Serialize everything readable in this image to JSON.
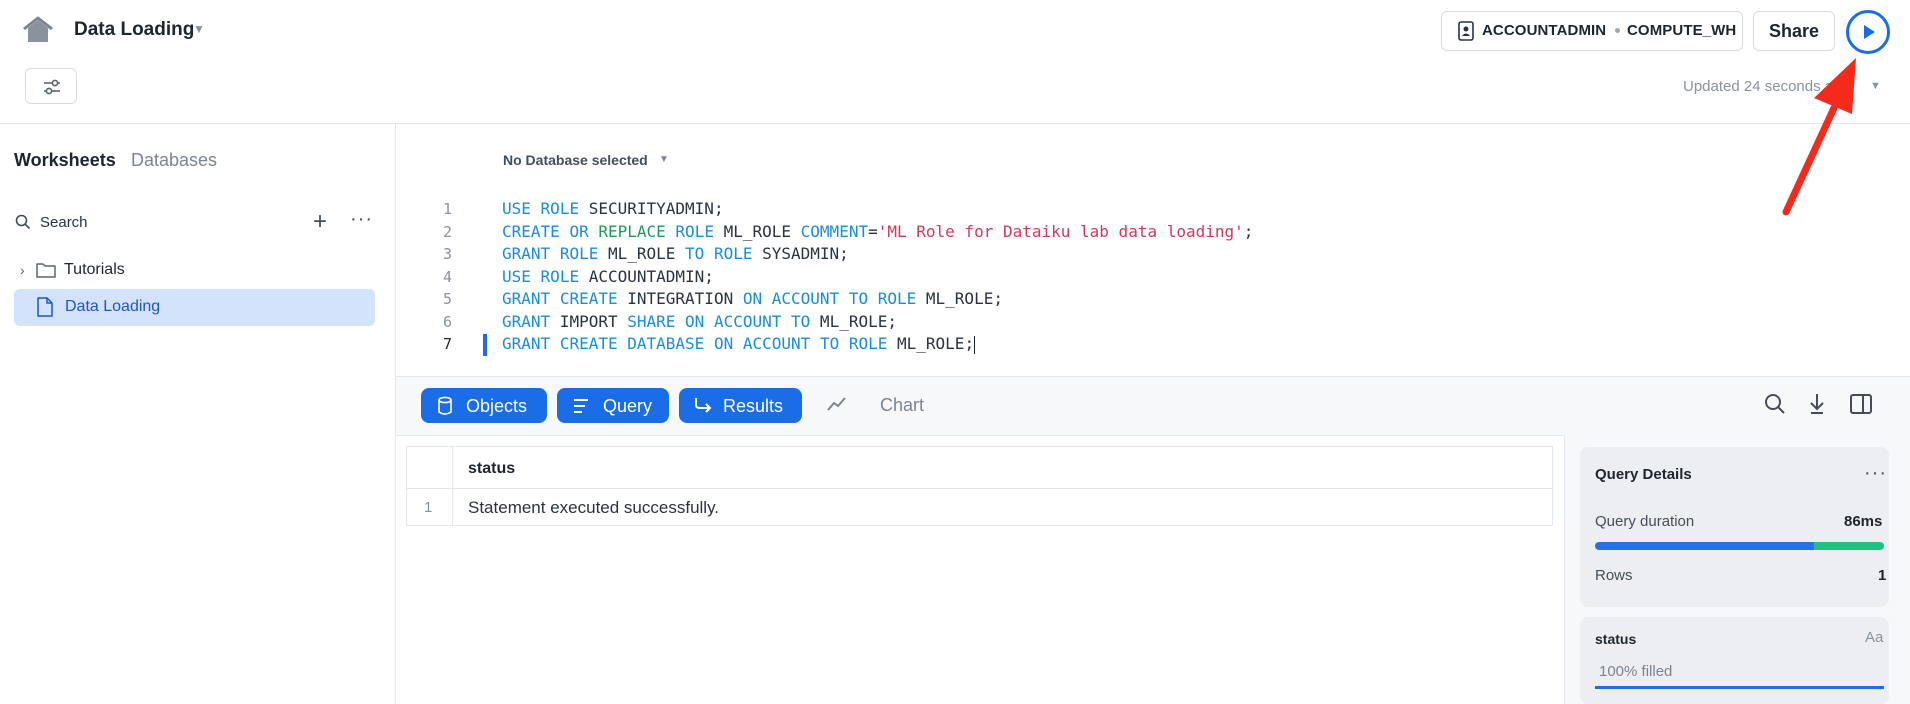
{
  "header": {
    "title": "Data Loading",
    "role": "ACCOUNTADMIN",
    "warehouse": "COMPUTE_WH",
    "share_label": "Share",
    "updated_text": "Updated 24 seconds ago"
  },
  "sidebar": {
    "tabs": [
      "Worksheets",
      "Databases"
    ],
    "search_label": "Search",
    "tree": [
      {
        "label": "Tutorials",
        "type": "folder"
      },
      {
        "label": "Data Loading",
        "type": "worksheet",
        "selected": true
      }
    ]
  },
  "editor": {
    "database_selector": "No Database selected",
    "line_numbers": [
      "1",
      "2",
      "3",
      "4",
      "5",
      "6",
      "7"
    ],
    "lines": [
      "USE ROLE SECURITYADMIN;",
      "CREATE OR REPLACE ROLE ML_ROLE COMMENT='ML Role for Dataiku lab data loading';",
      "GRANT ROLE ML_ROLE TO ROLE SYSADMIN;",
      "USE ROLE ACCOUNTADMIN;",
      "GRANT CREATE INTEGRATION ON ACCOUNT TO ROLE ML_ROLE;",
      "GRANT IMPORT SHARE ON ACCOUNT TO ML_ROLE;",
      "GRANT CREATE DATABASE ON ACCOUNT TO ROLE ML_ROLE;"
    ]
  },
  "results_toolbar": {
    "objects_label": "Objects",
    "query_label": "Query",
    "results_label": "Results",
    "chart_label": "Chart"
  },
  "results": {
    "columns": [
      "status"
    ],
    "rows": [
      {
        "index": "1",
        "status": "Statement executed successfully."
      }
    ]
  },
  "details": {
    "title": "Query Details",
    "duration_label": "Query duration",
    "duration_value": "86ms",
    "rows_label": "Rows",
    "rows_value": "1",
    "column_card": {
      "name": "status",
      "type_label": "Aa",
      "filled_text": "100% filled"
    }
  },
  "colors": {
    "accent": "#1a6ce7",
    "keyword": "#1a8ce0",
    "string": "#d1385b",
    "success": "#1fc180",
    "annotation_arrow": "#f42a1a"
  }
}
